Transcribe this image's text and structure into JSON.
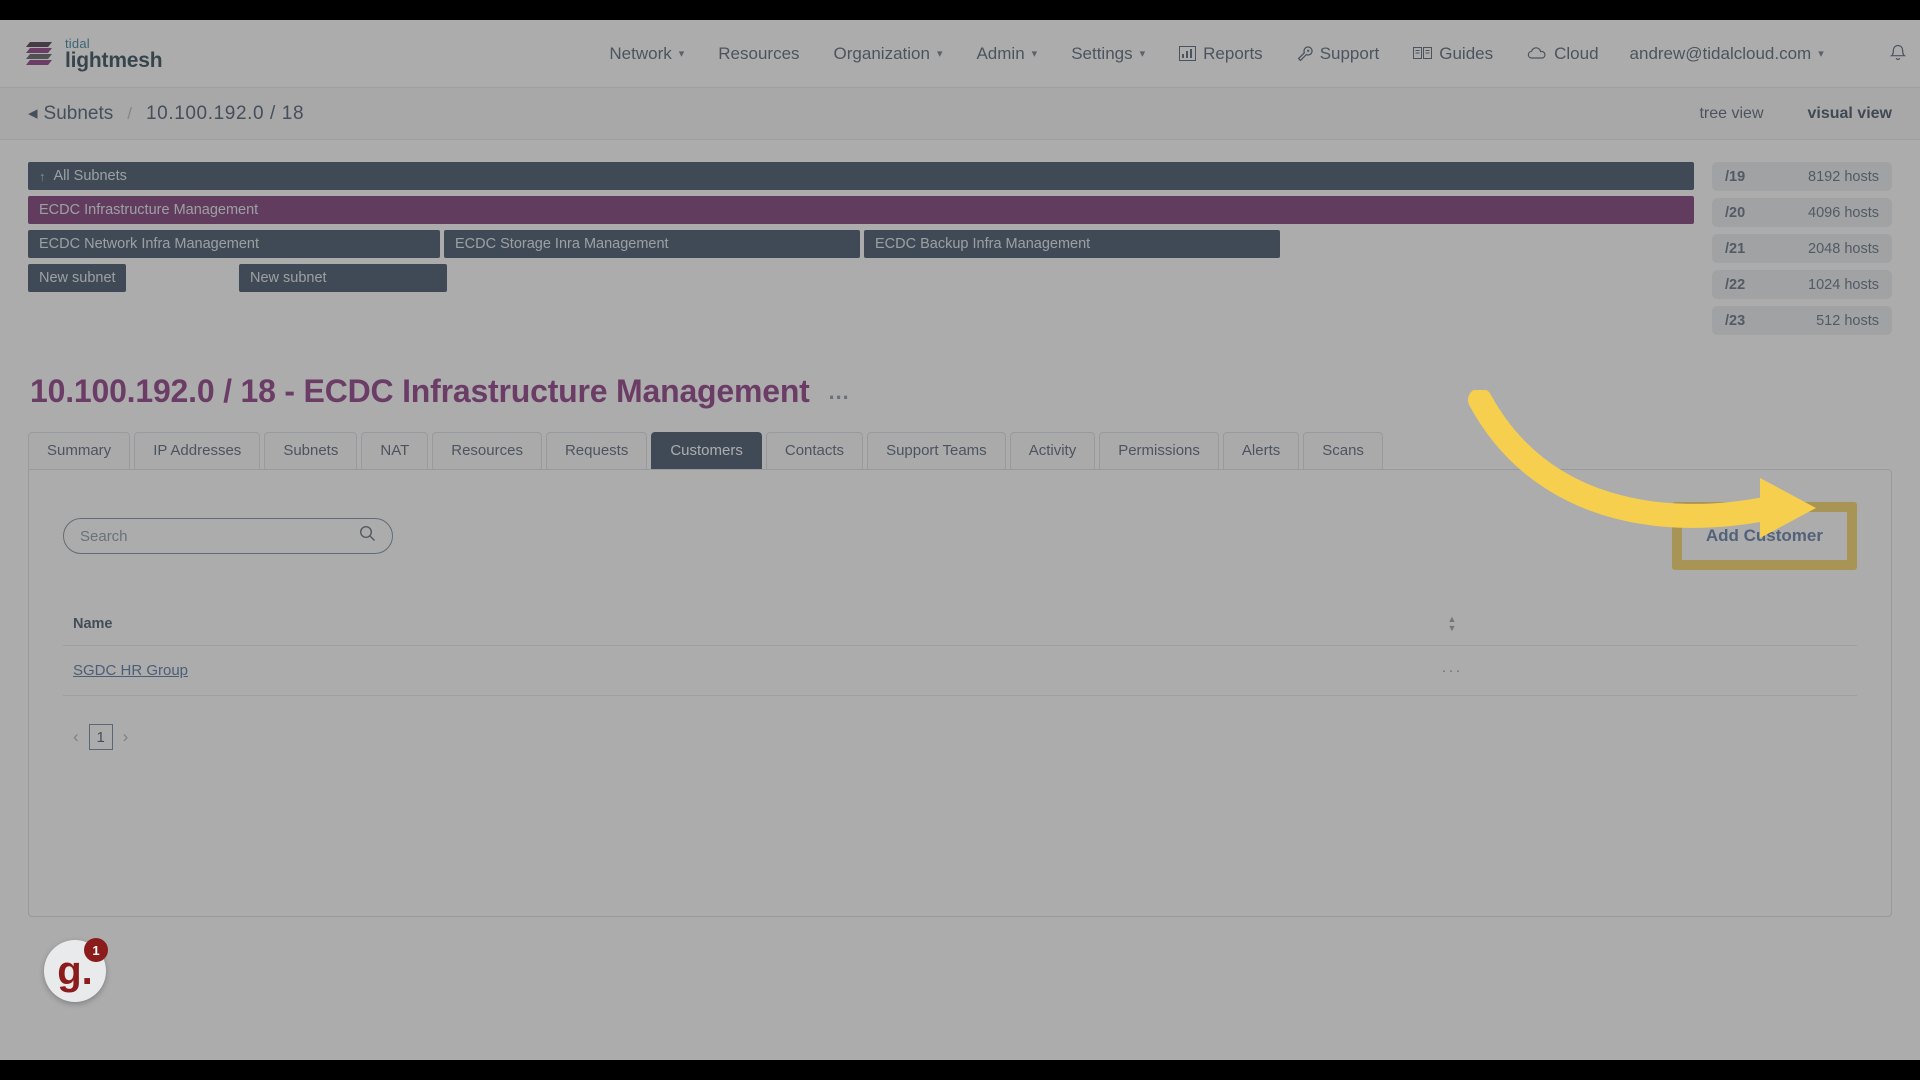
{
  "brand": {
    "line1": "tidal",
    "line2": "lightmesh"
  },
  "nav": {
    "items": [
      {
        "label": "Network",
        "caret": true,
        "icon": null
      },
      {
        "label": "Resources",
        "caret": false,
        "icon": null
      },
      {
        "label": "Organization",
        "caret": true,
        "icon": null
      },
      {
        "label": "Admin",
        "caret": true,
        "icon": null
      },
      {
        "label": "Settings",
        "caret": true,
        "icon": null
      },
      {
        "label": "Reports",
        "caret": false,
        "icon": "chart-icon"
      },
      {
        "label": "Support",
        "caret": false,
        "icon": "wrench-icon"
      },
      {
        "label": "Guides",
        "caret": false,
        "icon": "book-icon"
      },
      {
        "label": "Cloud",
        "caret": false,
        "icon": "cloud-icon"
      }
    ],
    "user": {
      "email": "andrew@tidalcloud.com",
      "caret": true
    },
    "bell_icon": "bell-icon"
  },
  "breadcrumb": {
    "back_label": "Subnets",
    "separator": "/",
    "current": "10.100.192.0 / 18",
    "views": [
      {
        "label": "tree view",
        "active": false
      },
      {
        "label": "visual view",
        "active": true
      }
    ]
  },
  "visualizer": {
    "all_subnets": "All Subnets",
    "parent": "ECDC Infrastructure Management",
    "children": [
      "ECDC Network Infra Management",
      "ECDC Storage Inra Management",
      "ECDC Backup Infra Management"
    ],
    "new_subnets": [
      "New subnet",
      "New subnet"
    ],
    "cidrs": [
      {
        "mask": "/19",
        "hosts": "8192 hosts"
      },
      {
        "mask": "/20",
        "hosts": "4096 hosts"
      },
      {
        "mask": "/21",
        "hosts": "2048 hosts"
      },
      {
        "mask": "/22",
        "hosts": "1024 hosts"
      },
      {
        "mask": "/23",
        "hosts": "512 hosts"
      }
    ]
  },
  "page": {
    "title": "10.100.192.0 / 18 - ECDC Infrastructure Management",
    "title_menu": "…"
  },
  "tabs": [
    {
      "label": "Summary",
      "active": false
    },
    {
      "label": "IP Addresses",
      "active": false
    },
    {
      "label": "Subnets",
      "active": false
    },
    {
      "label": "NAT",
      "active": false
    },
    {
      "label": "Resources",
      "active": false
    },
    {
      "label": "Requests",
      "active": false
    },
    {
      "label": "Customers",
      "active": true
    },
    {
      "label": "Contacts",
      "active": false
    },
    {
      "label": "Support Teams",
      "active": false
    },
    {
      "label": "Activity",
      "active": false
    },
    {
      "label": "Permissions",
      "active": false
    },
    {
      "label": "Alerts",
      "active": false
    },
    {
      "label": "Scans",
      "active": false
    }
  ],
  "customers_panel": {
    "search": {
      "value": "",
      "placeholder": "Search",
      "icon": "search-icon"
    },
    "add_button": {
      "label": "Add Customer",
      "highlight_color": "#f6cf4f"
    },
    "table": {
      "columns": [
        "Name"
      ],
      "rows": [
        {
          "name": "SGDC HR Group",
          "menu": "···"
        }
      ]
    },
    "pagination": {
      "prev": "‹",
      "pages": [
        "1"
      ],
      "next": "›"
    }
  },
  "widget": {
    "logo": "g.",
    "badge_count": "1"
  },
  "colors": {
    "navy": "#243b53",
    "purple": "#6b1f63",
    "title_purple": "#7a1f72",
    "highlight_yellow": "#f6cf4f",
    "link_blue": "#3f6292"
  }
}
